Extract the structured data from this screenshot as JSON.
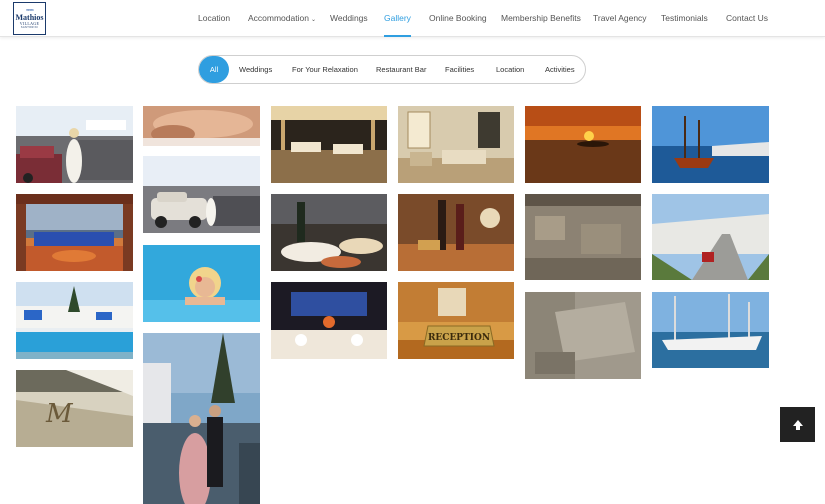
{
  "logo": {
    "name": "Mathios",
    "sub": "VILLAGE",
    "tiny": "SANTORINI"
  },
  "nav": {
    "items": [
      {
        "label": "Location"
      },
      {
        "label": "Accommodation"
      },
      {
        "label": "Weddings"
      },
      {
        "label": "Gallery"
      },
      {
        "label": "Online Booking"
      },
      {
        "label": "Membership Benefits"
      },
      {
        "label": "Travel Agency"
      },
      {
        "label": "Testimonials"
      },
      {
        "label": "Contact Us"
      }
    ],
    "active": "Gallery"
  },
  "filters": {
    "items": [
      "All",
      "Weddings",
      "For Your Relaxation",
      "Restaurant Bar",
      "Facilities",
      "Location",
      "Activities"
    ],
    "active": "All"
  },
  "gallery": {
    "photos": [
      {
        "subject": "wedding-car-bride"
      },
      {
        "subject": "sunset-terrace"
      },
      {
        "subject": "pool-windmill"
      },
      {
        "subject": "hotel-sign-logo"
      },
      {
        "subject": "massage-relaxation"
      },
      {
        "subject": "vintage-car-bride"
      },
      {
        "subject": "woman-in-pool"
      },
      {
        "subject": "couple-at-night"
      },
      {
        "subject": "restaurant-terrace-night"
      },
      {
        "subject": "buffet-wine"
      },
      {
        "subject": "dinner-by-pool"
      },
      {
        "subject": "lobby-lounge"
      },
      {
        "subject": "wine-bottles-chandelier"
      },
      {
        "subject": "reception-desk-sign"
      },
      {
        "subject": "sunset-sea"
      },
      {
        "subject": "ancient-ruins"
      },
      {
        "subject": "excavation-site"
      },
      {
        "subject": "sailing-ship"
      },
      {
        "subject": "island-road-scooter"
      },
      {
        "subject": "catamaran"
      }
    ],
    "reception_sign": "RECEPTION",
    "sign_script": "M"
  },
  "colors": {
    "accent": "#2f9ee0",
    "nav_text": "#555555",
    "back_top_bg": "#222222"
  },
  "back_to_top": {
    "icon": "arrow-up-icon"
  }
}
